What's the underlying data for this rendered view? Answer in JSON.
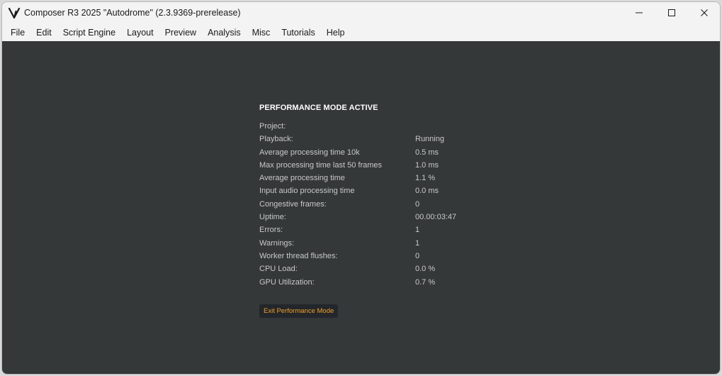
{
  "window": {
    "title": "Composer R3 2025 \"Autodrome\" (2.3.9369-prerelease)"
  },
  "menu": [
    "File",
    "Edit",
    "Script Engine",
    "Layout",
    "Preview",
    "Analysis",
    "Misc",
    "Tutorials",
    "Help"
  ],
  "performance": {
    "heading": "PERFORMANCE MODE ACTIVE",
    "stats": [
      {
        "label": "Project:",
        "value": ""
      },
      {
        "label": "Playback:",
        "value": "Running"
      },
      {
        "label": "Average processing time 10k",
        "value": "0.5 ms"
      },
      {
        "label": "Max processing time last 50 frames",
        "value": "1.0 ms"
      },
      {
        "label": "Average processing time",
        "value": "1.1 %"
      },
      {
        "label": "Input audio processing time",
        "value": "0.0 ms"
      },
      {
        "label": "Congestive frames:",
        "value": "0"
      },
      {
        "label": "Uptime:",
        "value": "00.00:03:47"
      },
      {
        "label": "Errors:",
        "value": "1"
      },
      {
        "label": "Warnings:",
        "value": "1"
      },
      {
        "label": "Worker thread flushes:",
        "value": "0"
      },
      {
        "label": "CPU Load:",
        "value": "0.0 %"
      },
      {
        "label": "GPU Utilization:",
        "value": "0.7 %"
      }
    ],
    "exit_label": "Exit Performance Mode"
  },
  "colors": {
    "content_bg": "#343839",
    "accent": "#f0a030"
  },
  "icons": [
    "app-logo-icon",
    "minimize-icon",
    "maximize-icon",
    "close-icon"
  ]
}
